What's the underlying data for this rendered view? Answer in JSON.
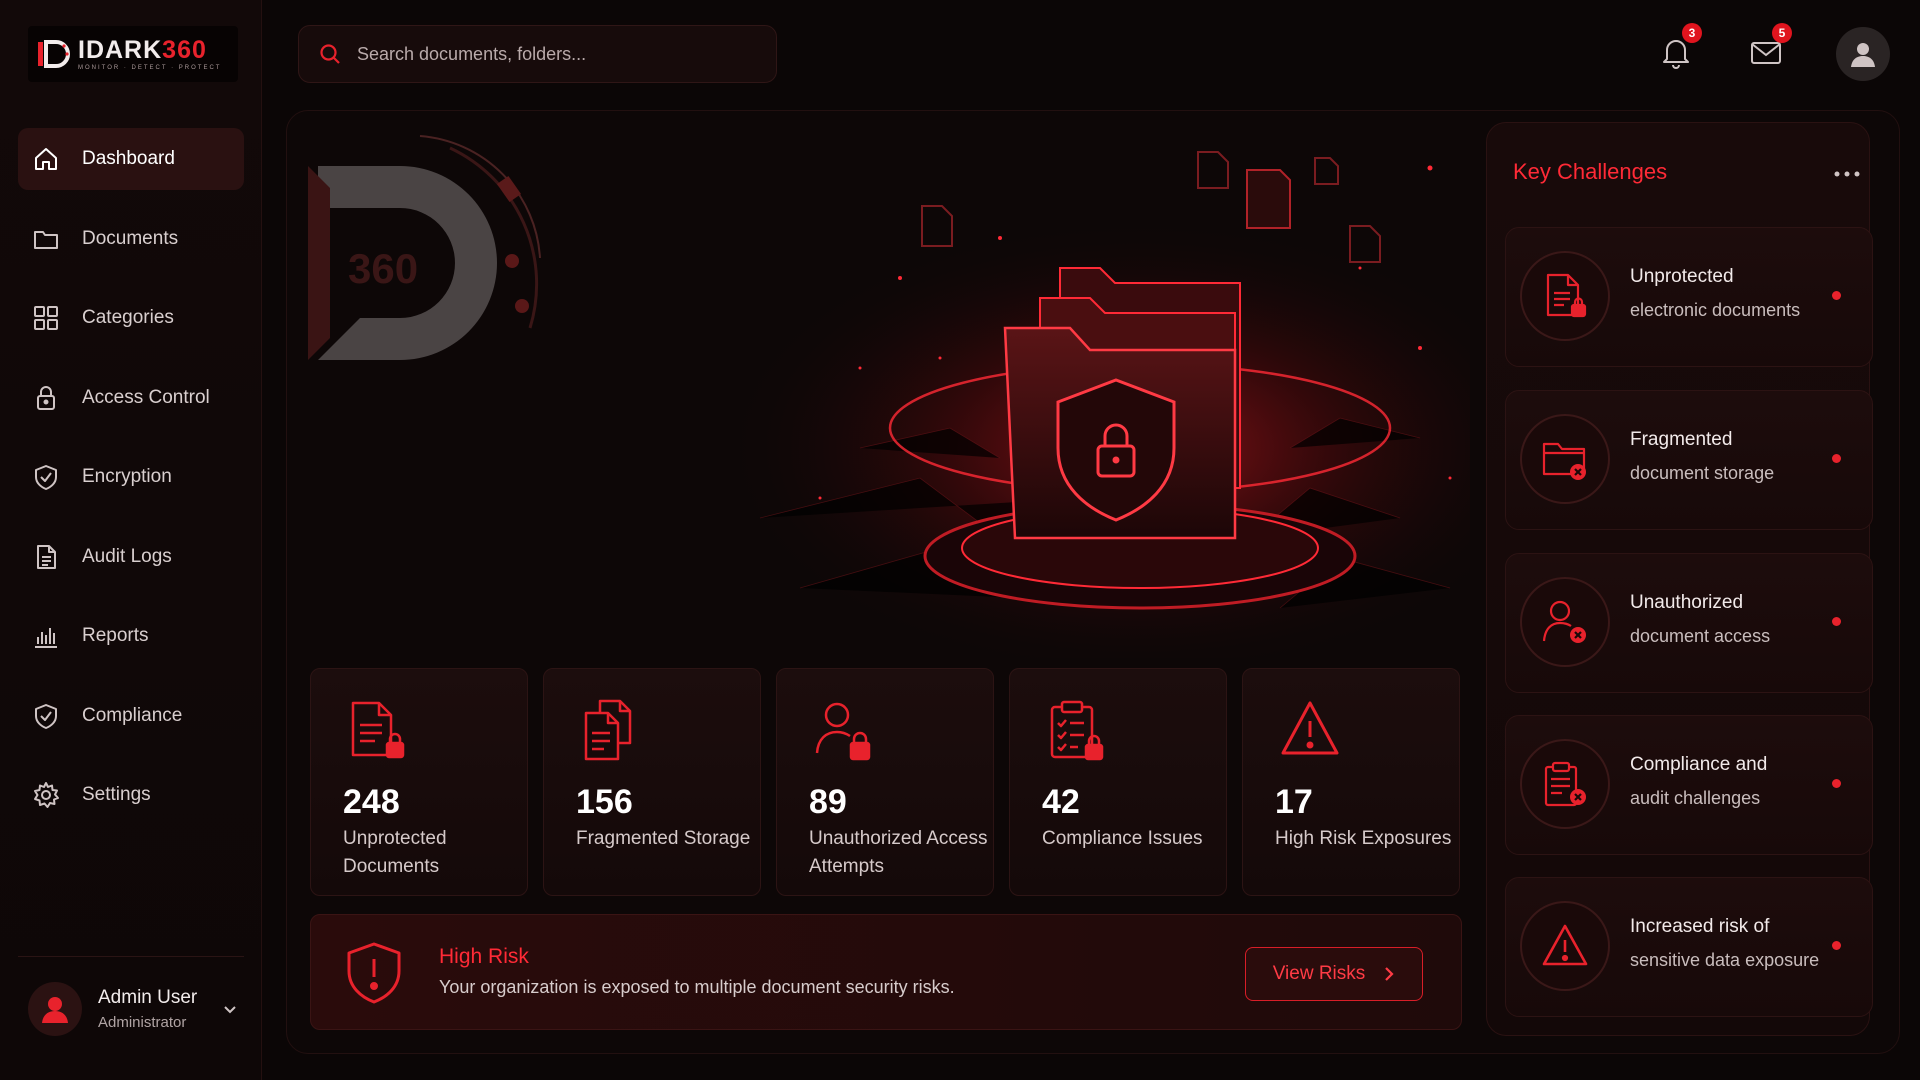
{
  "app": {
    "logo_left": "IDARK",
    "logo_right": "360",
    "logo_tagline": "MONITOR · DETECT · PROTECT"
  },
  "colors": {
    "accent": "#e8222c",
    "background": "#0b0606",
    "panel": "#170b0b"
  },
  "search": {
    "placeholder": "Search documents, folders...",
    "icon": "search-icon"
  },
  "topbar": {
    "notifications_count": "3",
    "messages_count": "5",
    "icons": [
      "bell-icon",
      "mail-icon",
      "user-avatar-icon"
    ]
  },
  "sidebar": {
    "items": [
      {
        "label": "Dashboard",
        "icon": "home-icon",
        "active": true
      },
      {
        "label": "Documents",
        "icon": "folder-icon"
      },
      {
        "label": "Categories",
        "icon": "grid-icon"
      },
      {
        "label": "Access Control",
        "icon": "lock-icon"
      },
      {
        "label": "Encryption",
        "icon": "shield-check-icon"
      },
      {
        "label": "Audit Logs",
        "icon": "document-icon"
      },
      {
        "label": "Reports",
        "icon": "bar-chart-icon"
      },
      {
        "label": "Compliance",
        "icon": "shield-check-icon"
      },
      {
        "label": "Settings",
        "icon": "gear-icon"
      }
    ]
  },
  "user": {
    "name": "Admin User",
    "role": "Administrator"
  },
  "hero": {
    "brand_number": "360"
  },
  "stats": [
    {
      "value": "248",
      "label": "Unprotected Documents",
      "icon": "document-lock-icon"
    },
    {
      "value": "156",
      "label": "Fragmented Storage",
      "icon": "documents-stack-icon"
    },
    {
      "value": "89",
      "label": "Unauthorized Access Attempts",
      "icon": "user-lock-icon"
    },
    {
      "value": "42",
      "label": "Compliance Issues",
      "icon": "clipboard-lock-icon"
    },
    {
      "value": "17",
      "label": "High Risk Exposures",
      "icon": "warning-icon"
    }
  ],
  "risk": {
    "title": "High Risk",
    "description": "Your organization is exposed to multiple document security risks.",
    "button": "View Risks"
  },
  "key_challenges": {
    "title": "Key Challenges",
    "items": [
      {
        "line1": "Unprotected",
        "line2": "electronic documents",
        "icon": "document-lock-icon"
      },
      {
        "line1": "Fragmented",
        "line2": "document storage",
        "icon": "folder-x-icon"
      },
      {
        "line1": "Unauthorized",
        "line2": "document access",
        "icon": "user-x-icon"
      },
      {
        "line1": "Compliance and",
        "line2": "audit challenges",
        "icon": "clipboard-x-icon"
      },
      {
        "line1": "Increased risk of",
        "line2": "sensitive data exposure",
        "icon": "warning-icon"
      }
    ]
  }
}
